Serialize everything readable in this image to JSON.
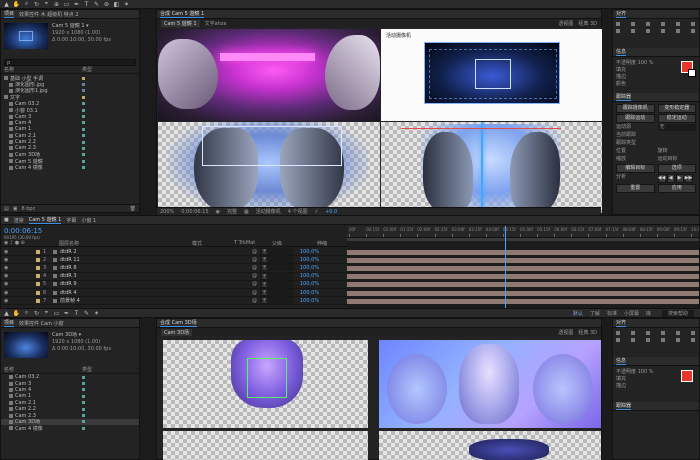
{
  "colors": {
    "accent": "#3b8ee0",
    "time": "#4aa3ff",
    "layer": "#8f7a71",
    "red": "#e8362a"
  },
  "menu": {
    "items": [
      "默认",
      "了解",
      "标准",
      "小屏幕",
      "库"
    ],
    "search": "搜索帮助"
  },
  "top": {
    "project_tab": "项目",
    "effects_tab": "效果控件 木 超级机 特点 2",
    "comp_tab": "合成 Cam 5 遊鏡 1",
    "comp_sub": [
      "Cam 5 遊鏡 1",
      "文字ahza"
    ],
    "asset": {
      "name": "Cam 5 遊鏡 1 ▾",
      "size": "1920 x 1080 (1.00)",
      "duration": "Δ 0:00:10:00, 30.00 fps"
    },
    "search_placeholder": "ρ",
    "col_name": "名称",
    "col_type": "类型",
    "items": [
      {
        "name": "基础 小型 手调",
        "color": "#c4a95a",
        "indent": 0
      },
      {
        "name": "演化图形.jpg",
        "color": "#6f7f9e",
        "indent": 1
      },
      {
        "name": "演化图形1.jpg",
        "color": "#6f7f9e",
        "indent": 1
      },
      {
        "name": "文字",
        "color": "#c4a95a",
        "indent": 0
      },
      {
        "name": "Cam 03.2",
        "color": "#55a59a",
        "indent": 1
      },
      {
        "name": "小窗 03.1",
        "color": "#55a59a",
        "indent": 1
      },
      {
        "name": "Cam 3",
        "color": "#55a59a",
        "indent": 1
      },
      {
        "name": "Cam 4",
        "color": "#55a59a",
        "indent": 1
      },
      {
        "name": "Cam 1",
        "color": "#55a59a",
        "indent": 1
      },
      {
        "name": "Cam 2.1",
        "color": "#55a59a",
        "indent": 1
      },
      {
        "name": "Cam 2.2",
        "color": "#55a59a",
        "indent": 1
      },
      {
        "name": "Cam 2.3",
        "color": "#55a59a",
        "indent": 1
      },
      {
        "name": "Cam 3D场",
        "color": "#55a59a",
        "indent": 1
      },
      {
        "name": "Cam 5 遊鏡",
        "color": "#55a59a",
        "indent": 1
      },
      {
        "name": "Cam 4 镜像",
        "color": "#55a59a",
        "indent": 1
      }
    ],
    "bpc": "8 bpc",
    "viewer_label_a": "活动摄像机",
    "view_mode": "透视图",
    "view_count": "经典 3D",
    "zoom": "200%",
    "timecode": "0:00:06:15",
    "quality": "完整",
    "camera": "活动摄像机",
    "views": "4 个视图",
    "exposure": "+0.0"
  },
  "right": {
    "align_title": "对齐",
    "tracker_title": "跟踪器",
    "info_title": "信息",
    "props": [
      "不透明度 100 %",
      "填充",
      "描边",
      "颜色"
    ],
    "tracker_labels": [
      "跟踪摄像机",
      "变形稳定器",
      "跟踪运动",
      "稳定运动",
      "运动源",
      "当前跟踪",
      "跟踪类型",
      "位置",
      "旋转",
      "缩放",
      "运动目标",
      "编辑目标",
      "选项",
      "分析",
      "重置",
      "应用"
    ],
    "motion_source": "无",
    "analyze_buttons": [
      "◀◀",
      "◀",
      "▶",
      "▶▶"
    ]
  },
  "timeline": {
    "tabs": [
      {
        "label": "渲染",
        "active": false
      },
      {
        "label": "Cam 5 遊鏡 1",
        "active": true
      },
      {
        "label": "字幕",
        "active": false
      },
      {
        "label": "小窗 1",
        "active": false
      }
    ],
    "timecode": "0:00:06:15",
    "timecode_sub": "00195 (30.00 fps)",
    "col_source": "图层名称",
    "col_mode": "模式",
    "col_trkmat": "T TrkMat",
    "col_parent": "父级",
    "col_stretch": "伸缩",
    "ruler": [
      "00f",
      "00:15f",
      "01:00f",
      "01:15f",
      "02:00f",
      "02:15f",
      "03:00f",
      "03:15f",
      "04:00f",
      "04:15f",
      "05:00f",
      "05:15f",
      "06:00f",
      "06:15f",
      "07:00f",
      "07:15f",
      "08:00f",
      "08:15f",
      "09:00f",
      "09:15f",
      "10:0"
    ],
    "playhead": 0.45,
    "layers": [
      {
        "num": "1",
        "name": "dtdR 2",
        "parent": "无",
        "stretch": "100.0%",
        "color": "#c9b16a"
      },
      {
        "num": "2",
        "name": "dtdR 11",
        "parent": "无",
        "stretch": "100.0%",
        "color": "#c9b16a"
      },
      {
        "num": "3",
        "name": "dtdR 8",
        "parent": "无",
        "stretch": "100.0%",
        "color": "#c9b16a"
      },
      {
        "num": "4",
        "name": "dtdR 3",
        "parent": "无",
        "stretch": "100.0%",
        "color": "#c9b16a"
      },
      {
        "num": "5",
        "name": "dtdR 9",
        "parent": "无",
        "stretch": "100.0%",
        "color": "#c9b16a"
      },
      {
        "num": "6",
        "name": "dtdR 4",
        "parent": "无",
        "stretch": "100.0%",
        "color": "#c9b16a"
      },
      {
        "num": "7",
        "name": "前景帧 4",
        "parent": "无",
        "stretch": "100.0%",
        "color": "#c9b16a"
      }
    ]
  },
  "bottom": {
    "project_tab": "项目",
    "effects_tab": "效果控件 Cam 小窗",
    "comp_tab": "合成 Cam 3D场",
    "comp_sub": "Cam 3D场",
    "asset": {
      "name": "Cam 3D场 ▾",
      "size": "1920 x 1080 (1.00)",
      "duration": "Δ 0:00:10:00, 30.00 fps"
    },
    "view_mode": "透视图",
    "view_count": "经典 3D",
    "items": [
      {
        "name": "Cam 03.2",
        "color": "#55a59a"
      },
      {
        "name": "Cam 3",
        "color": "#55a59a"
      },
      {
        "name": "Cam 4",
        "color": "#55a59a"
      },
      {
        "name": "Cam 1",
        "color": "#55a59a"
      },
      {
        "name": "Cam 2.1",
        "color": "#55a59a"
      },
      {
        "name": "Cam 2.2",
        "color": "#55a59a"
      },
      {
        "name": "Cam 2.3",
        "color": "#55a59a"
      },
      {
        "name": "Cam 3D场",
        "color": "#55a59a"
      },
      {
        "name": "Cam 4 镜像",
        "color": "#55a59a"
      }
    ]
  }
}
